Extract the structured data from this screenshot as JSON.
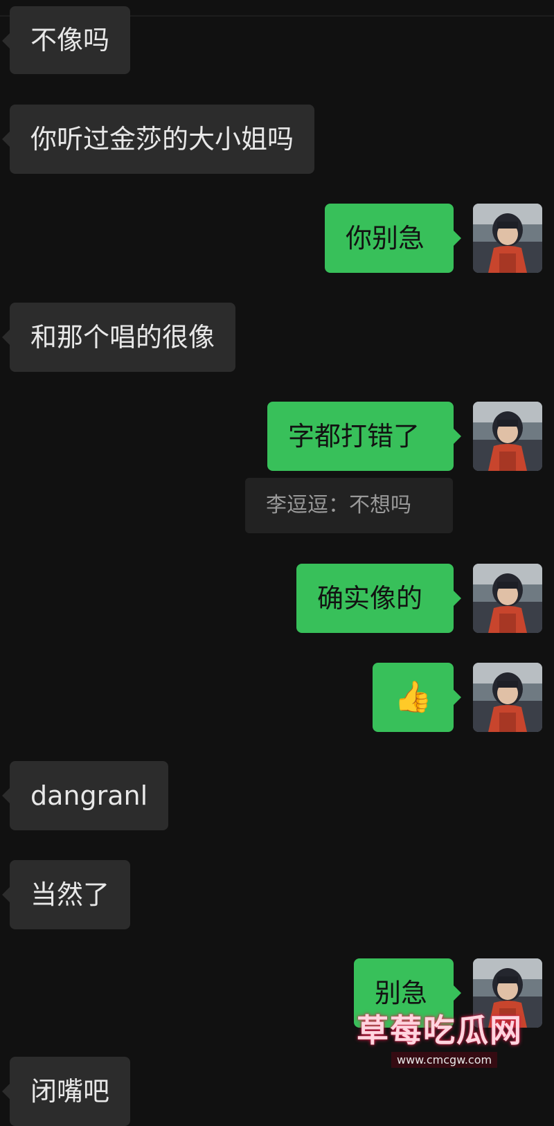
{
  "messages": [
    {
      "side": "left",
      "text": "不像吗"
    },
    {
      "side": "left",
      "text": "你听过金莎的大小姐吗"
    },
    {
      "side": "right",
      "text": "你别急"
    },
    {
      "side": "left",
      "text": "和那个唱的很像"
    },
    {
      "side": "right",
      "text": "字都打错了",
      "quote": "李逗逗：不想吗"
    },
    {
      "side": "right",
      "text": "确实像的"
    },
    {
      "side": "right",
      "text": "👍",
      "icon": "thumbs-up-emoji"
    },
    {
      "side": "left",
      "text": "dangranl"
    },
    {
      "side": "left",
      "text": "当然了"
    },
    {
      "side": "right",
      "text": "别急"
    },
    {
      "side": "left",
      "text": "闭嘴吧"
    }
  ],
  "watermark": {
    "title": "草莓吃瓜网",
    "url": "www.cmcgw.com"
  },
  "colors": {
    "background": "#111111",
    "incoming": "#2c2c2c",
    "outgoing": "#38c05a"
  }
}
